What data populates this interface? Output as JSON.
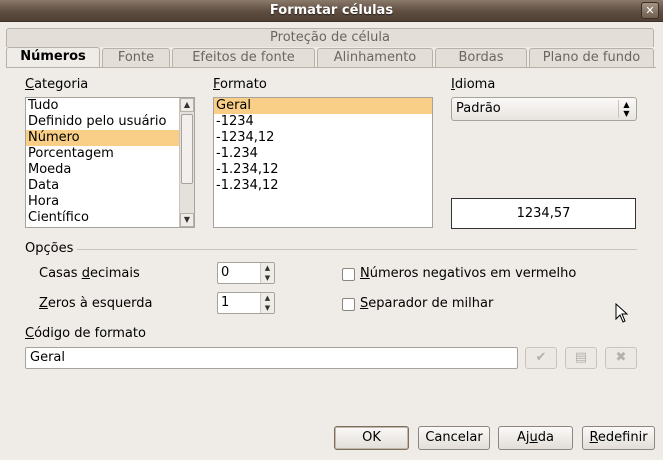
{
  "window": {
    "title": "Formatar células",
    "close_glyph": "✕"
  },
  "tabs": {
    "row1": [
      "Proteção de célula"
    ],
    "row2": [
      "Números",
      "Fonte",
      "Efeitos de fonte",
      "Alinhamento",
      "Bordas",
      "Plano de fundo"
    ],
    "active": "Números"
  },
  "categoria": {
    "label_first": "C",
    "label_rest": "ategoria",
    "items": [
      "Tudo",
      "Definido pelo usuário",
      "Número",
      "Porcentagem",
      "Moeda",
      "Data",
      "Hora",
      "Científico"
    ],
    "selected": "Número"
  },
  "formato": {
    "label_first": "F",
    "label_rest": "ormato",
    "items": [
      "Geral",
      "-1234",
      "-1234,12",
      "-1.234",
      "-1.234,12",
      "-1.234,12"
    ],
    "selected": "Geral"
  },
  "idioma": {
    "label_first": "I",
    "label_rest": "dioma",
    "value": "Padrão"
  },
  "preview": {
    "value": "1234,57"
  },
  "opcoes": {
    "label": "Opções",
    "casas_decimais": {
      "label_pre": "Casas ",
      "label_u": "d",
      "label_post": "ecimais",
      "value": "0"
    },
    "zeros_esquerda": {
      "label_u": "Z",
      "label_post": "eros à esquerda",
      "value": "1"
    },
    "negativos_vermelho": {
      "label_u": "N",
      "label_post": "úmeros negativos em vermelho",
      "checked": false
    },
    "separador_milhar": {
      "label_u": "S",
      "label_post": "eparador de milhar",
      "checked": false
    }
  },
  "codigo": {
    "label_u": "C",
    "label_post": "ódigo de formato",
    "value": "Geral"
  },
  "icons": {
    "accept": "check-icon",
    "comment": "comment-icon",
    "delete": "delete-icon"
  },
  "buttons": {
    "ok": "OK",
    "cancel": "Cancelar",
    "help_pre": "Aj",
    "help_u": "u",
    "help_post": "da",
    "reset_u": "R",
    "reset_post": "edefinir"
  },
  "colors": {
    "selection": "#f9ce86",
    "titlebar": "#5e4d40",
    "background": "#efebe7"
  }
}
